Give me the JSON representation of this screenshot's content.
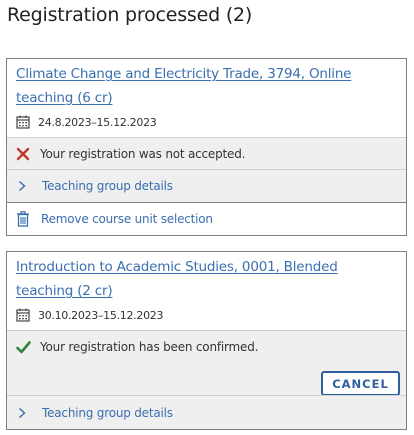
{
  "page": {
    "title": "Registration processed (2)"
  },
  "registrations": [
    {
      "course_title": "Climate Change and Electricity Trade, 3794, Online teaching (6 cr)",
      "dates": "24.8.2023–15.12.2023",
      "status": "Your registration was not accepted.",
      "status_icon": "cross-icon",
      "teaching_group_label": "Teaching group details",
      "remove_label": "Remove course unit selection"
    },
    {
      "course_title": "Introduction to Academic Studies, 0001, Blended teaching (2 cr)",
      "dates": "30.10.2023–15.12.2023",
      "status": "Your registration has been confirmed.",
      "status_icon": "check-icon",
      "cancel_label": "CANCEL",
      "teaching_group_label": "Teaching group details"
    }
  ],
  "colors": {
    "link": "#3a6fb0",
    "error": "#c0392b",
    "success": "#2e8540",
    "section_bg": "#efefef",
    "button_border": "#2f5f9e"
  }
}
